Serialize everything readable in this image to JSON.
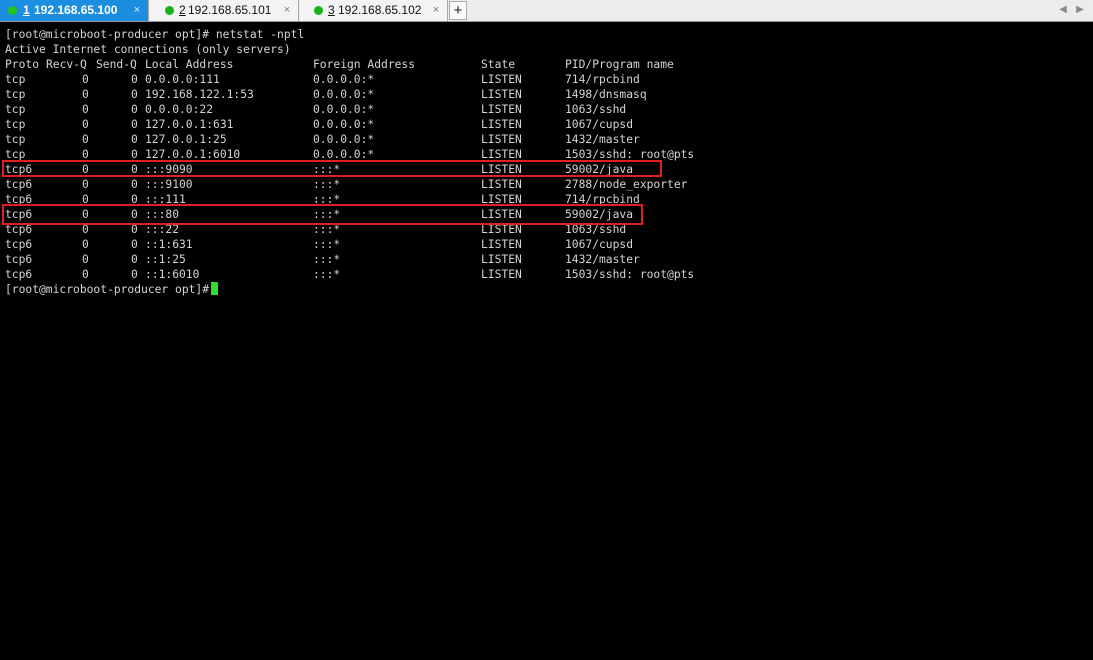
{
  "tabs": [
    {
      "num": "1",
      "ip": "192.168.65.100",
      "close": "×",
      "active": true
    },
    {
      "num": "2",
      "ip": "192.168.65.101",
      "close": "×",
      "active": false
    },
    {
      "num": "3",
      "ip": "192.168.65.102",
      "close": "×",
      "active": false
    }
  ],
  "tab_add_label": "+",
  "nav": {
    "left": "◀",
    "right": "▶"
  },
  "colors": {
    "tab_active": "#1c8ee0",
    "status_dot": "#18b218",
    "cursor": "#2ee02e",
    "highlight": "#e02020",
    "terminal_bg": "#000000",
    "terminal_fg": "#d4d4d4"
  },
  "terminal": {
    "command": "[root@microboot-producer opt]# netstat -nptl",
    "info": "Active Internet connections (only servers)",
    "headers": {
      "proto": "Proto",
      "recvq": "Recv-Q",
      "sendq": "Send-Q",
      "local": "Local Address",
      "foreign": "Foreign Address",
      "state": "State",
      "pid": "PID/Program name"
    },
    "rows": [
      {
        "proto": "tcp",
        "recvq": "0",
        "sendq": "0",
        "local": "0.0.0.0:111",
        "foreign": "0.0.0.0:*",
        "state": "LISTEN",
        "pid": "714/rpcbind"
      },
      {
        "proto": "tcp",
        "recvq": "0",
        "sendq": "0",
        "local": "192.168.122.1:53",
        "foreign": "0.0.0.0:*",
        "state": "LISTEN",
        "pid": "1498/dnsmasq"
      },
      {
        "proto": "tcp",
        "recvq": "0",
        "sendq": "0",
        "local": "0.0.0.0:22",
        "foreign": "0.0.0.0:*",
        "state": "LISTEN",
        "pid": "1063/sshd"
      },
      {
        "proto": "tcp",
        "recvq": "0",
        "sendq": "0",
        "local": "127.0.0.1:631",
        "foreign": "0.0.0.0:*",
        "state": "LISTEN",
        "pid": "1067/cupsd"
      },
      {
        "proto": "tcp",
        "recvq": "0",
        "sendq": "0",
        "local": "127.0.0.1:25",
        "foreign": "0.0.0.0:*",
        "state": "LISTEN",
        "pid": "1432/master"
      },
      {
        "proto": "tcp",
        "recvq": "0",
        "sendq": "0",
        "local": "127.0.0.1:6010",
        "foreign": "0.0.0.0:*",
        "state": "LISTEN",
        "pid": "1503/sshd: root@pts"
      },
      {
        "proto": "tcp6",
        "recvq": "0",
        "sendq": "0",
        "local": ":::9090",
        "foreign": ":::*",
        "state": "LISTEN",
        "pid": "59002/java"
      },
      {
        "proto": "tcp6",
        "recvq": "0",
        "sendq": "0",
        "local": ":::9100",
        "foreign": ":::*",
        "state": "LISTEN",
        "pid": "2788/node_exporter"
      },
      {
        "proto": "tcp6",
        "recvq": "0",
        "sendq": "0",
        "local": ":::111",
        "foreign": ":::*",
        "state": "LISTEN",
        "pid": "714/rpcbind"
      },
      {
        "proto": "tcp6",
        "recvq": "0",
        "sendq": "0",
        "local": ":::80",
        "foreign": ":::*",
        "state": "LISTEN",
        "pid": "59002/java"
      },
      {
        "proto": "tcp6",
        "recvq": "0",
        "sendq": "0",
        "local": ":::22",
        "foreign": ":::*",
        "state": "LISTEN",
        "pid": "1063/sshd"
      },
      {
        "proto": "tcp6",
        "recvq": "0",
        "sendq": "0",
        "local": "::1:631",
        "foreign": ":::*",
        "state": "LISTEN",
        "pid": "1067/cupsd"
      },
      {
        "proto": "tcp6",
        "recvq": "0",
        "sendq": "0",
        "local": "::1:25",
        "foreign": ":::*",
        "state": "LISTEN",
        "pid": "1432/master"
      },
      {
        "proto": "tcp6",
        "recvq": "0",
        "sendq": "0",
        "local": "::1:6010",
        "foreign": ":::*",
        "state": "LISTEN",
        "pid": "1503/sshd: root@pts"
      }
    ],
    "prompt": "[root@microboot-producer opt]#"
  }
}
